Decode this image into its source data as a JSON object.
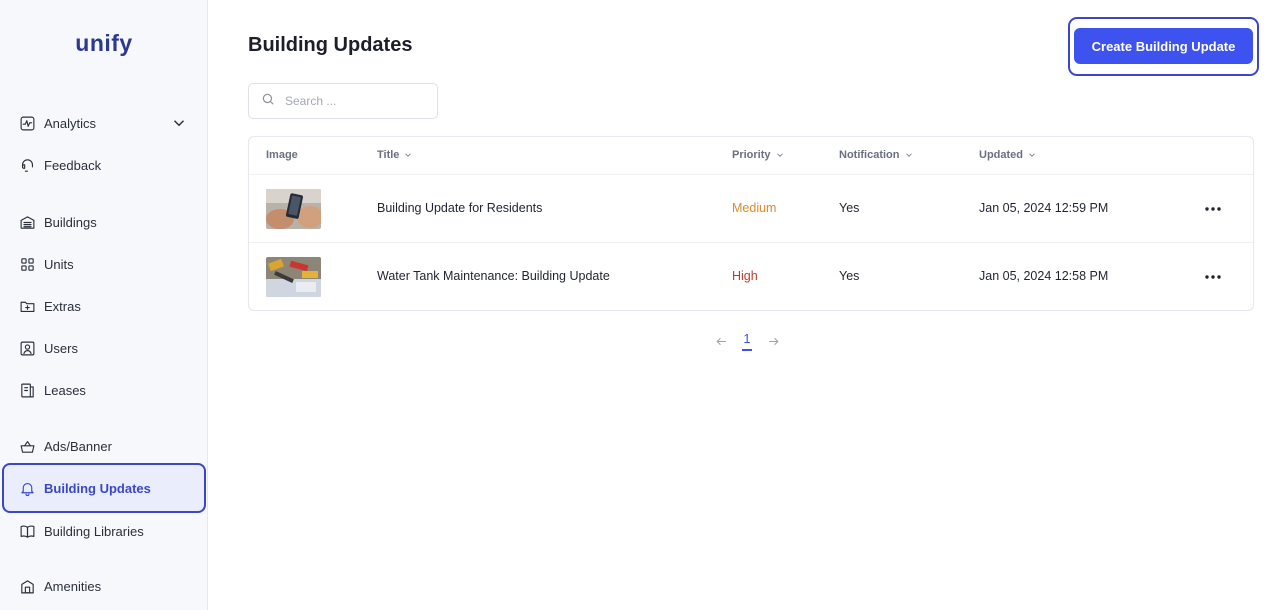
{
  "sidebar": {
    "logo": "unify",
    "items": [
      {
        "label": "Analytics",
        "icon": "analytics-icon"
      },
      {
        "label": "Feedback",
        "icon": "feedback-icon"
      },
      {
        "label": "Buildings",
        "icon": "building-icon"
      },
      {
        "label": "Units",
        "icon": "grid-icon"
      },
      {
        "label": "Extras",
        "icon": "folder-plus-icon"
      },
      {
        "label": "Users",
        "icon": "user-icon"
      },
      {
        "label": "Leases",
        "icon": "lease-icon"
      },
      {
        "label": "Ads/Banner",
        "icon": "basket-icon"
      },
      {
        "label": "Building Updates",
        "icon": "bell-icon",
        "active": true
      },
      {
        "label": "Building Libraries",
        "icon": "book-icon"
      },
      {
        "label": "Amenities",
        "icon": "amenity-icon"
      }
    ]
  },
  "header": {
    "title": "Building Updates",
    "create_label": "Create Building Update"
  },
  "search": {
    "placeholder": "Search ..."
  },
  "table": {
    "columns": [
      "Image",
      "Title",
      "Priority",
      "Notification",
      "Updated"
    ],
    "rows": [
      {
        "title": "Building Update for Residents",
        "priority": "Medium",
        "notification": "Yes",
        "updated": "Jan 05, 2024 12:59 PM"
      },
      {
        "title": "Water Tank Maintenance: Building Update",
        "priority": "High",
        "notification": "Yes",
        "updated": "Jan 05, 2024 12:58 PM"
      }
    ]
  },
  "pagination": {
    "current": "1"
  },
  "colors": {
    "accent": "#3e52f0",
    "active_border": "#3b47c7",
    "medium": "#e08a2a",
    "high": "#c0392b"
  }
}
